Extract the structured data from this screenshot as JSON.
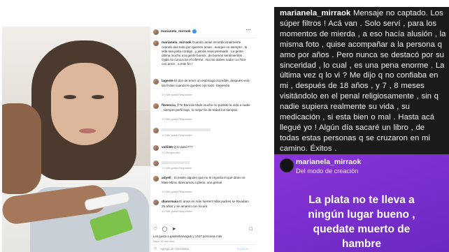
{
  "post": {
    "username": "marianela_mirraok",
    "verified_icon": "verified-badge-icon",
    "more_icon": "more-horizontal-icon",
    "caption": "Cuando amas incondicionalmente , cuando das todo por quienes amas , aunque no siempre , la vida sea justa contigo , y jamás seas premiado . La gente última mucho a la gente buena , de buenos sentimientos . Ojalá no conozcan el infierno . No me debes nada ! Lo hice con amor , a este fin !",
    "comments": [
      {
        "user": "lagente",
        "text": "El don de tener un estómago increíble, después veía las frutas cuando lo quedes con todo. Sepeedía",
        "meta": "1 h   Me gusta   Responder"
      },
      {
        "user": "florencia_f",
        "text": "Te Bancás Male mucho no pudiste la vida a nadie , siempre perfil bajo, lo mejor fin de todas los tiempos",
        "meta": "1 h   Me gusta   Responder"
      },
      {
        "user": "",
        "text": "",
        "meta": "1 h   Me gusta   Responder"
      },
      {
        "user": "valiii65",
        "text": "Q lo pasó???",
        "meta": "1 h   Responder"
      },
      {
        "user": "",
        "text": "",
        "meta": "1 h   Me gusta   Responder"
      },
      {
        "user": "adyell_",
        "text": "Si existe alguien que no le importa el qué dirán es Male Mirra. Bancamos a pleno. una genial",
        "meta": "1 h   Me gusta   Responder"
      },
      {
        "user": "dlamrmaia",
        "text": "El amor es más fuerte!!! Más padres se Rivadam . 25 años y se amaron con locura",
        "meta": "1 h   Me gusta   Responder"
      }
    ],
    "likes_text": "Les gusta a gastonbravoguti y 1447 personas más",
    "time_ago": "Hace 50 minutos",
    "add_comment_placeholder": "Agrega un comentario...",
    "post_button": "Publicar"
  },
  "story1": {
    "username": "marianela_mirraok",
    "text": "Mensaje no captado. Los súper filtros ! Acá van .  Solo serví , para los momentos de mierda , a eso hacía alusión , la misma foto , quise acompañar a la persona q amo por años . Pero nunca se destacó por su sinceridad , lo cual , es una pena enorme . La última vez q lo vi ? Me dijo q no confiaba en mi , después de 18 años , y 7 , 8 meses visitándolo en el penal religiosamente , sin q nadie supiera realmente su vida , su medicación , si esta bien o mal . Hasta acá llegué yo ! Algún día sacaré un libro , de todas estas personas q se cruzaron en mi camino. Éxitos ."
  },
  "story2": {
    "username": "marianela_mirraok",
    "subtitle": "Del modo de creación",
    "lines": [
      "La plata no te lleva a",
      "ningún lugar bueno ,",
      "quedate muerto de",
      "hambre"
    ]
  }
}
